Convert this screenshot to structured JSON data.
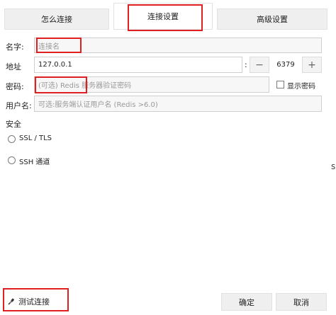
{
  "tabs": [
    {
      "label": "怎么连接"
    },
    {
      "label": "连接设置"
    },
    {
      "label": "高级设置"
    }
  ],
  "form": {
    "name_label": "名字:",
    "name_placeholder": "连接名",
    "address_label": "地址",
    "address_value": "127.0.0.1",
    "colon": ":",
    "port_minus": "−",
    "port_value": "6379",
    "port_plus": "+",
    "password_label": "密码:",
    "password_placeholder": "(可选) Redis 服务器验证密码",
    "show_password_label": "显示密码",
    "username_label": "用户名:",
    "username_placeholder": "可选:服务端认证用户名 (Redis >6.0)"
  },
  "security": {
    "title": "安全",
    "options": [
      {
        "label": "SSL / TLS"
      },
      {
        "label": "SSH 通道"
      }
    ]
  },
  "footer": {
    "test_label": "测试连接",
    "ok_label": "确定",
    "cancel_label": "取消"
  },
  "side_glyph": "s",
  "colors": {
    "highlight": "#e02020"
  }
}
